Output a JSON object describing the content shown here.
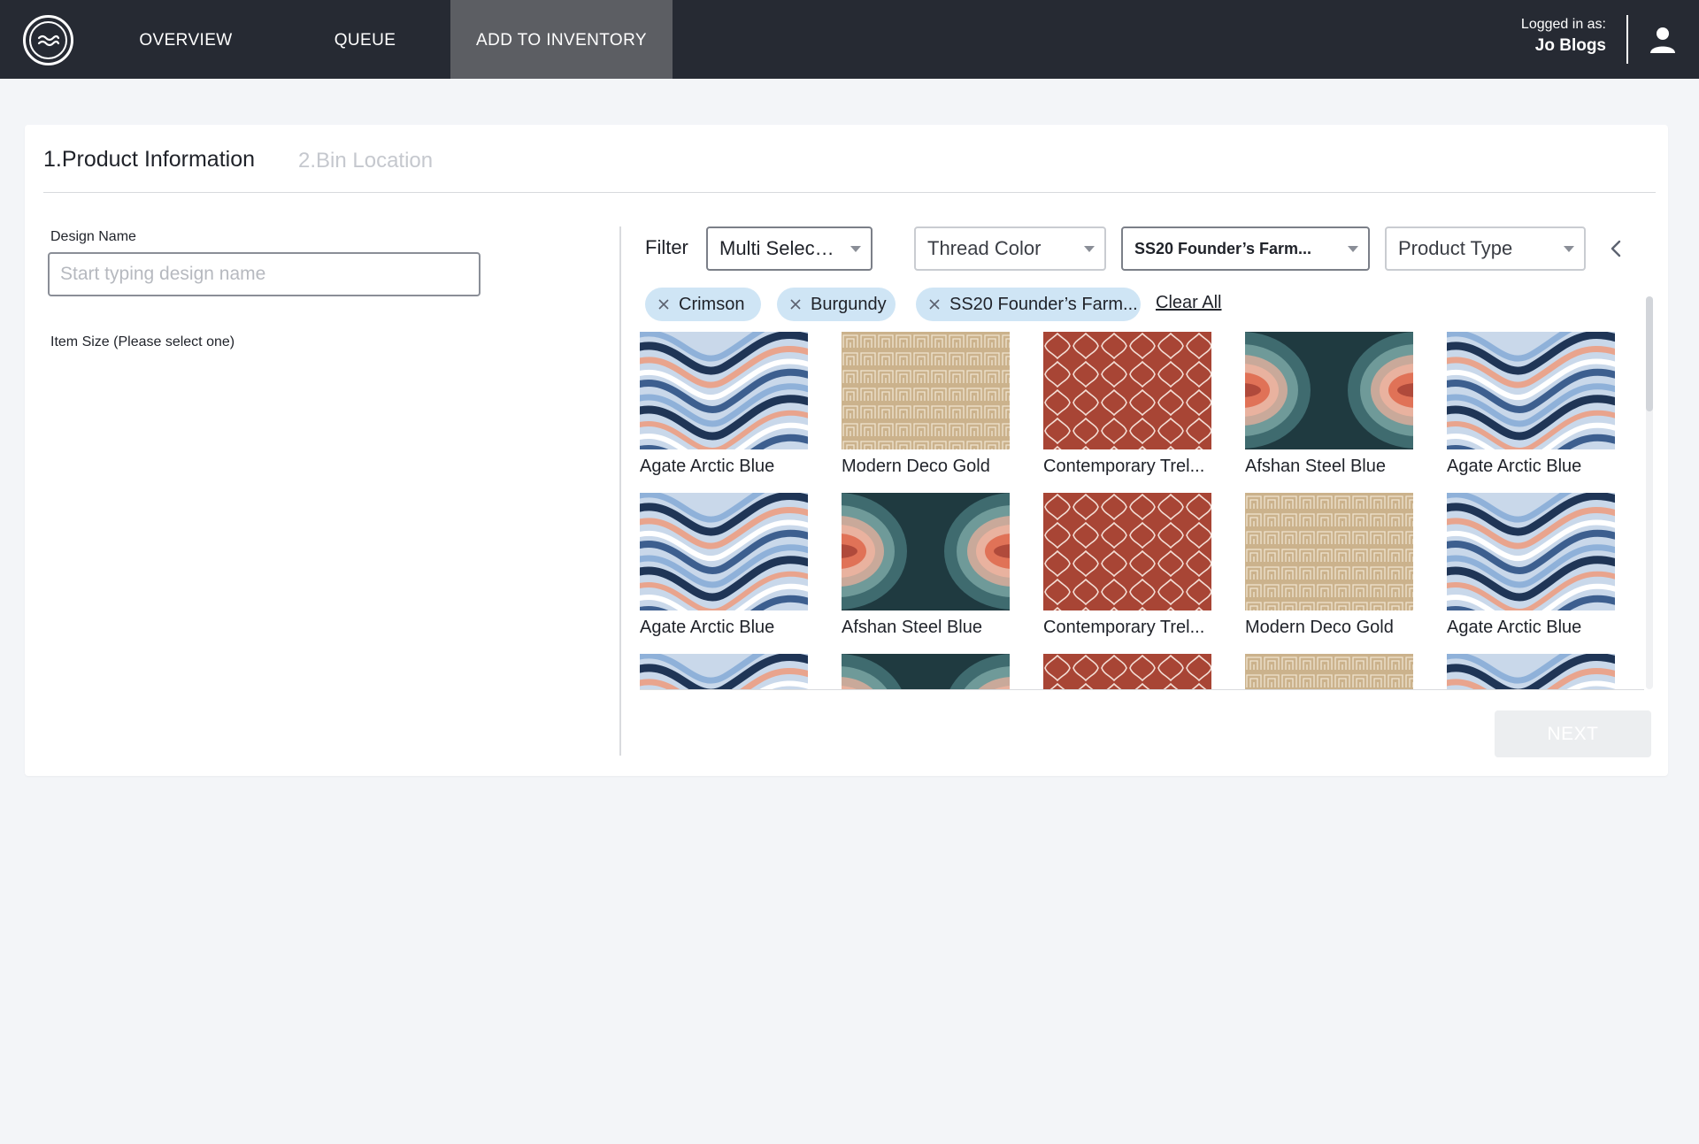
{
  "nav": {
    "items": [
      {
        "label": "OVERVIEW"
      },
      {
        "label": "QUEUE"
      },
      {
        "label": "ADD TO INVENTORY",
        "active": true
      }
    ],
    "login_label": "Logged in as:",
    "user_name": "Jo Blogs"
  },
  "steps": {
    "active": "1.Product Information",
    "next": "2.Bin Location"
  },
  "form": {
    "design_name_label": "Design Name",
    "design_name_placeholder": "Start typing design name",
    "design_name_value": "",
    "item_size_label": "Item Size (Please select one)"
  },
  "filter": {
    "label": "Filter",
    "dropdowns": [
      {
        "value": "Multi Selected"
      },
      {
        "value": "Thread Color"
      },
      {
        "value": "SS20 Founder’s Farm..."
      },
      {
        "value": "Product Type"
      }
    ],
    "chips": [
      "Crimson",
      "Burgundy",
      "SS20 Founder’s Farm..."
    ],
    "clear_all": "Clear All"
  },
  "products": [
    {
      "name": "Agate Arctic Blue",
      "pattern": "agate"
    },
    {
      "name": "Modern Deco Gold",
      "pattern": "deco"
    },
    {
      "name": "Contemporary Trel...",
      "pattern": "trellis"
    },
    {
      "name": "Afshan Steel Blue",
      "pattern": "afshan"
    },
    {
      "name": "Agate Arctic Blue",
      "pattern": "agate"
    },
    {
      "name": "Agate Arctic Blue",
      "pattern": "agate"
    },
    {
      "name": "Afshan Steel Blue",
      "pattern": "afshan"
    },
    {
      "name": "Contemporary Trel...",
      "pattern": "trellis"
    },
    {
      "name": "Modern Deco Gold",
      "pattern": "deco"
    },
    {
      "name": "Agate Arctic Blue",
      "pattern": "agate"
    },
    {
      "name": "",
      "pattern": "agate"
    },
    {
      "name": "",
      "pattern": "afshan"
    },
    {
      "name": "",
      "pattern": "trellis"
    },
    {
      "name": "",
      "pattern": "deco"
    },
    {
      "name": "",
      "pattern": "agate"
    }
  ],
  "actions": {
    "next_label": "NEXT"
  },
  "colors": {
    "topbar": "#262a33",
    "nav_active": "#5c5e63",
    "chip_bg": "#cfe5f5",
    "trellis": "#a84535",
    "deco": "#cbb28c",
    "afshan_bg": "#1f3a40",
    "afshan_accent": "#e07257"
  },
  "icons": {
    "logo": "wave-logo-icon",
    "user": "user-icon",
    "collapse": "chevron-left-icon",
    "chip_remove": "close-icon",
    "dropdown": "caret-down-icon"
  }
}
